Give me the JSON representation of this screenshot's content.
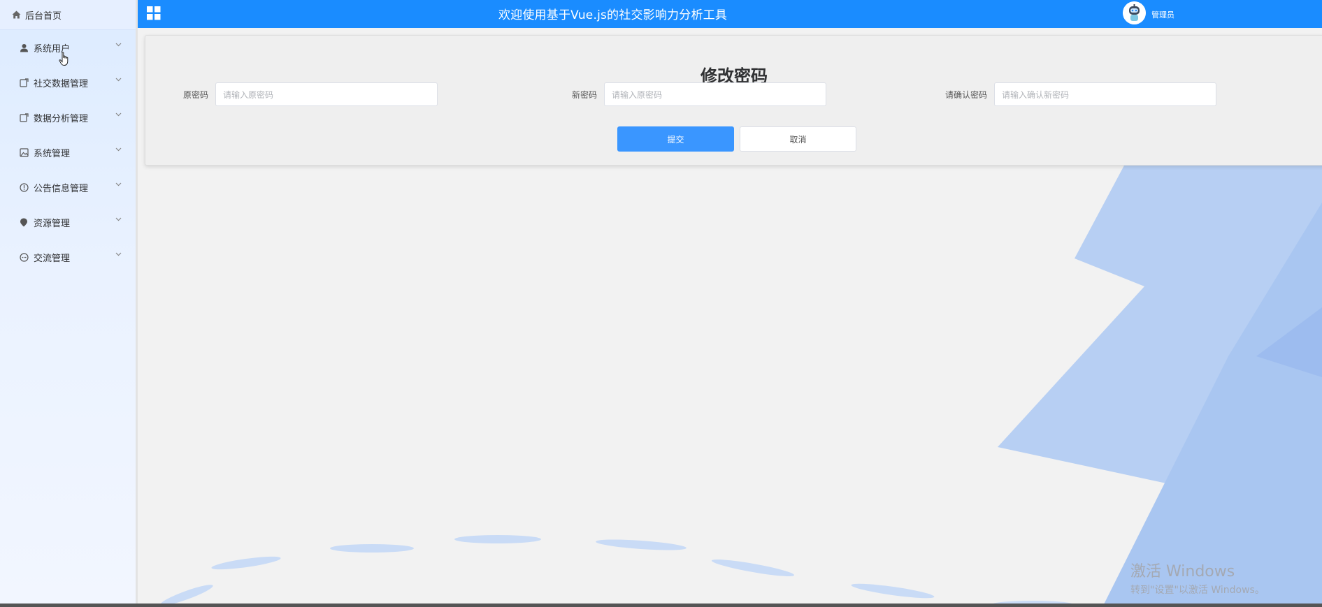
{
  "sidebar": {
    "home_label": "后台首页",
    "items": [
      {
        "label": "系统用户",
        "icon": "user-icon"
      },
      {
        "label": "社交数据管理",
        "icon": "document-icon"
      },
      {
        "label": "数据分析管理",
        "icon": "document-icon"
      },
      {
        "label": "系统管理",
        "icon": "image-icon"
      },
      {
        "label": "公告信息管理",
        "icon": "warning-circle-icon"
      },
      {
        "label": "资源管理",
        "icon": "location-pin-icon"
      },
      {
        "label": "交流管理",
        "icon": "chat-bubble-icon"
      }
    ]
  },
  "header": {
    "title": "欢迎使用基于Vue.js的社交影响力分析工具",
    "user_name": "管理员",
    "colors": {
      "bar": "#1a8cff"
    }
  },
  "form": {
    "title": "修改密码",
    "fields": [
      {
        "label": "原密码",
        "placeholder": "请输入原密码"
      },
      {
        "label": "新密码",
        "placeholder": "请输入原密码"
      },
      {
        "label": "请确认密码",
        "placeholder": "请输入确认新密码"
      }
    ],
    "submit_label": "提交",
    "cancel_label": "取消"
  },
  "watermark": {
    "line1": "激活 Windows",
    "line2": "转到\"设置\"以激活 Windows。"
  }
}
